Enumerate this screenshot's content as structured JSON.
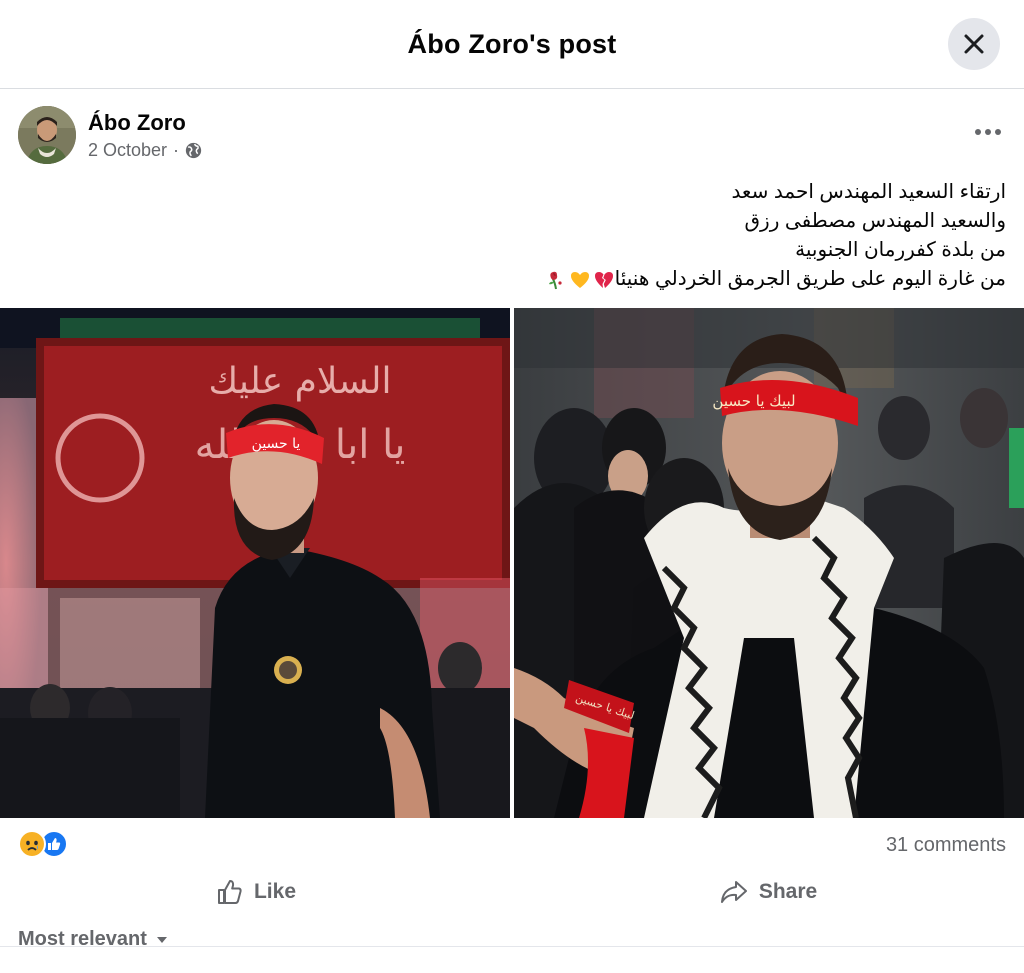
{
  "header": {
    "title": "Ábo Zoro's post"
  },
  "post": {
    "author": "Ábo Zoro",
    "date": "2 October",
    "date_separator": "·",
    "text_lines": [
      "ارتقاء السعيد المهندس احمد سعد",
      "والسعيد المهندس مصطفى رزق",
      "من بلدة كفررمان الجنوبية",
      "من غارة اليوم على طريق الجرمق الخردلي هنيئا"
    ],
    "emojis": [
      "broken-heart",
      "yellow-heart",
      "wilted-rose"
    ]
  },
  "photos": {
    "left_headband_text": "يا حسين",
    "right_headband_text": "لبيك يا حسين",
    "banner_text": "السلام عليك يا ابا عبد الله"
  },
  "engagement": {
    "reactions": [
      "sad-reaction",
      "like-reaction"
    ],
    "comments": "31 comments"
  },
  "actions": {
    "like": "Like",
    "share": "Share"
  },
  "comments_sort": {
    "label": "Most relevant"
  },
  "colors": {
    "accent_blue": "#1877f2",
    "sad_yellow": "#f7b125",
    "text_secondary": "#65676b"
  }
}
